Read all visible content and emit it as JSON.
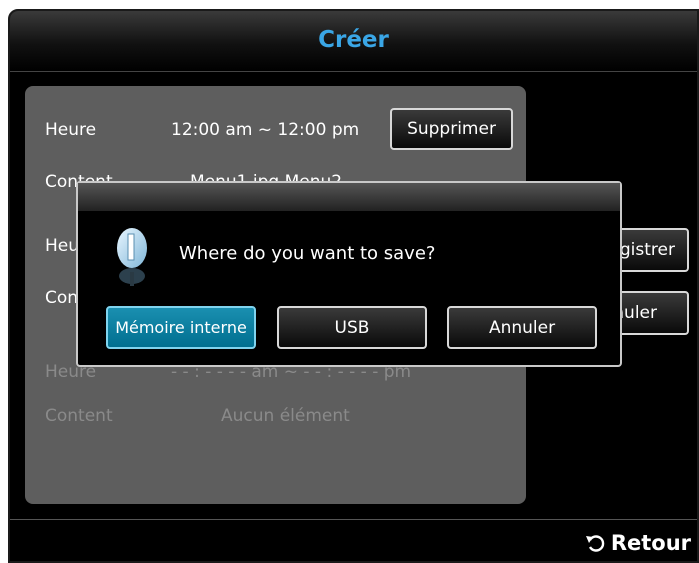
{
  "window": {
    "title": "Créer"
  },
  "schedule": {
    "rows": [
      {
        "time_label": "Heure",
        "time_value": "12:00 am ~ 12:00 pm",
        "content_label": "Content",
        "content_value": "Menu1.jpg,Menu2..."
      },
      {
        "time_label": "Heure",
        "content_label": "Content"
      },
      {
        "time_label": "Heure",
        "time_value": "- - : - -   - -  am   ~  - - : - -   - -  pm",
        "content_label": "Content",
        "content_value": "Aucun élément"
      }
    ],
    "delete_label": "Supprimer"
  },
  "side_buttons": {
    "save_label": "Enregistrer",
    "cancel_label": "Annuler"
  },
  "dialog": {
    "question": "Where do you want to save?",
    "options": [
      "Mémoire interne",
      "USB",
      "Annuler"
    ],
    "selected": "Mémoire interne"
  },
  "footer": {
    "back_label": "Retour"
  },
  "colors": {
    "title": "#3aa6e6",
    "selected_button": "#1a8fb0"
  }
}
